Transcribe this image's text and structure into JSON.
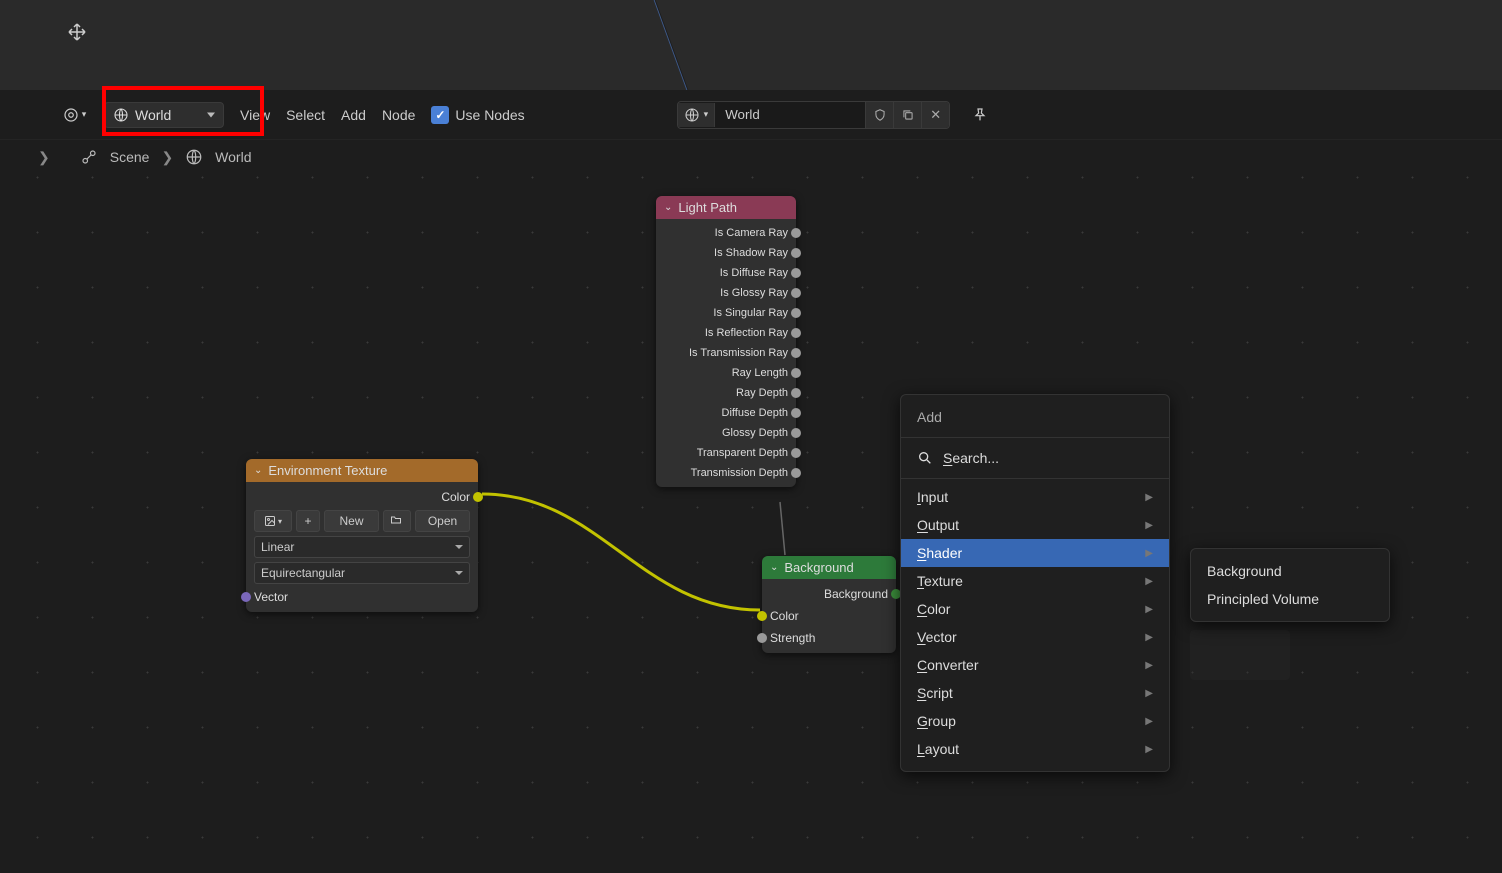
{
  "header": {
    "shader_type": "World",
    "menu": {
      "view": "View",
      "select": "Select",
      "add": "Add",
      "node": "Node"
    },
    "use_nodes_label": "Use Nodes",
    "world_field_value": "World",
    "pin_icon": "pin"
  },
  "breadcrumb": {
    "scene": "Scene",
    "world": "World"
  },
  "nodes": {
    "light_path": {
      "title": "Light Path",
      "outputs": [
        "Is Camera Ray",
        "Is Shadow Ray",
        "Is Diffuse Ray",
        "Is Glossy Ray",
        "Is Singular Ray",
        "Is Reflection Ray",
        "Is Transmission Ray",
        "Ray Length",
        "Ray Depth",
        "Diffuse Depth",
        "Glossy Depth",
        "Transparent Depth",
        "Transmission Depth"
      ]
    },
    "env_texture": {
      "title": "Environment Texture",
      "out_color": "Color",
      "btn_new": "New",
      "btn_open": "Open",
      "interp": "Linear",
      "projection": "Equirectangular",
      "in_vector": "Vector"
    },
    "background": {
      "title": "Background",
      "out_bg": "Background",
      "in_color": "Color",
      "in_strength": "Strength"
    }
  },
  "add_menu": {
    "title": "Add",
    "search_label": "Search...",
    "categories": [
      "Input",
      "Output",
      "Shader",
      "Texture",
      "Color",
      "Vector",
      "Converter",
      "Script",
      "Group",
      "Layout"
    ],
    "selected": "Shader",
    "shader_submenu": [
      "Background",
      "Principled Volume"
    ]
  }
}
